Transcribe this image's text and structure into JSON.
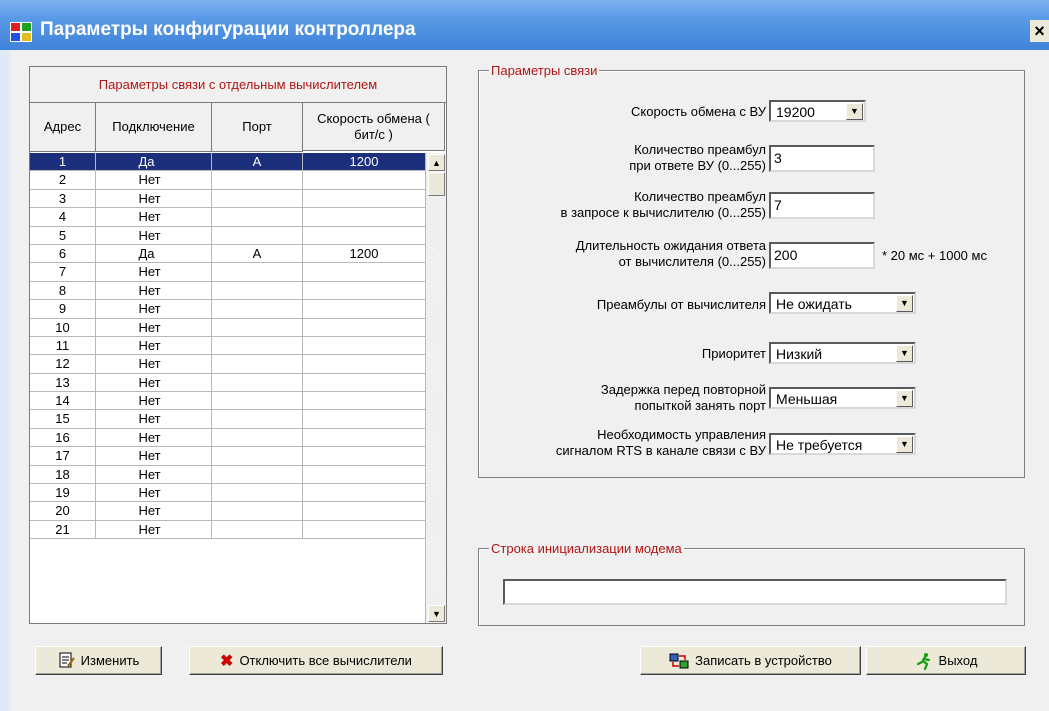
{
  "window": {
    "title": "Параметры конфигурации контроллера",
    "close_glyph": "×",
    "icon": "app-icon"
  },
  "grid": {
    "caption": "Параметры связи  с отдельным вычислителем",
    "headers": [
      "Адрес",
      "Подключение",
      "Порт",
      "Скорость обмена ( бит/с )"
    ],
    "rows": [
      {
        "addr": "1",
        "conn": "Да",
        "port": "A",
        "speed": "1200",
        "selected": true
      },
      {
        "addr": "2",
        "conn": "Нет",
        "port": "",
        "speed": ""
      },
      {
        "addr": "3",
        "conn": "Нет",
        "port": "",
        "speed": ""
      },
      {
        "addr": "4",
        "conn": "Нет",
        "port": "",
        "speed": ""
      },
      {
        "addr": "5",
        "conn": "Нет",
        "port": "",
        "speed": ""
      },
      {
        "addr": "6",
        "conn": "Да",
        "port": "A",
        "speed": "1200"
      },
      {
        "addr": "7",
        "conn": "Нет",
        "port": "",
        "speed": ""
      },
      {
        "addr": "8",
        "conn": "Нет",
        "port": "",
        "speed": ""
      },
      {
        "addr": "9",
        "conn": "Нет",
        "port": "",
        "speed": ""
      },
      {
        "addr": "10",
        "conn": "Нет",
        "port": "",
        "speed": ""
      },
      {
        "addr": "11",
        "conn": "Нет",
        "port": "",
        "speed": ""
      },
      {
        "addr": "12",
        "conn": "Нет",
        "port": "",
        "speed": ""
      },
      {
        "addr": "13",
        "conn": "Нет",
        "port": "",
        "speed": ""
      },
      {
        "addr": "14",
        "conn": "Нет",
        "port": "",
        "speed": ""
      },
      {
        "addr": "15",
        "conn": "Нет",
        "port": "",
        "speed": ""
      },
      {
        "addr": "16",
        "conn": "Нет",
        "port": "",
        "speed": ""
      },
      {
        "addr": "17",
        "conn": "Нет",
        "port": "",
        "speed": ""
      },
      {
        "addr": "18",
        "conn": "Нет",
        "port": "",
        "speed": ""
      },
      {
        "addr": "19",
        "conn": "Нет",
        "port": "",
        "speed": ""
      },
      {
        "addr": "20",
        "conn": "Нет",
        "port": "",
        "speed": ""
      },
      {
        "addr": "21",
        "conn": "Нет",
        "port": "",
        "speed": ""
      }
    ]
  },
  "comm": {
    "title": "Параметры связи",
    "baud_label": "Скорость обмена с ВУ",
    "baud_value": "19200",
    "preamb_reply_label1": "Количество преамбул",
    "preamb_reply_label2": "при ответе ВУ (0...255)",
    "preamb_reply_value": "3",
    "preamb_req_label1": "Количество преамбул",
    "preamb_req_label2": "в запросе к вычислителю (0...255)",
    "preamb_req_value": "7",
    "timeout_label1": "Длительность ожидания ответа",
    "timeout_label2": "от вычислителя (0...255)",
    "timeout_value": "200",
    "timeout_suffix": "* 20 мс + 1000 мс",
    "preamb_from_label": "Преамбулы от вычислителя",
    "preamb_from_value": "Не ожидать",
    "priority_label": "Приоритет",
    "priority_value": "Низкий",
    "delay_label1": "Задержка перед повторной",
    "delay_label2": "попыткой занять порт",
    "delay_value": "Меньшая",
    "rts_label1": "Необходимость управления",
    "rts_label2": "сигналом RTS в канале связи с ВУ",
    "rts_value": "Не требуется"
  },
  "modem": {
    "title": "Строка инициализации модема",
    "value": ""
  },
  "buttons": {
    "edit": "Изменить",
    "disconnect_all": "Отключить все вычислители",
    "write": "Записать в устройство",
    "exit": "Выход"
  },
  "colors": {
    "title_bar": "#3f82da",
    "group_title": "#b01616",
    "selection": "#1c2f7c"
  }
}
